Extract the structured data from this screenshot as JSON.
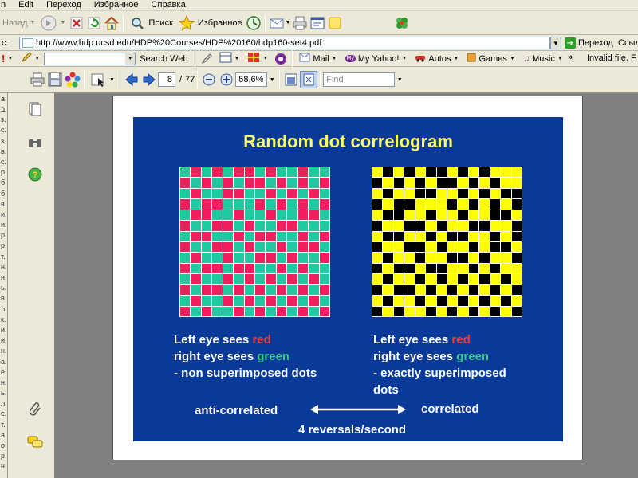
{
  "menubar": {
    "items": [
      "n",
      "Edit",
      "Переход",
      "Избранное",
      "Справка"
    ]
  },
  "toolbar": {
    "back_label": "Назад",
    "search_label": "Поиск",
    "favorites_label": "Избранное"
  },
  "address": {
    "label": "с:",
    "url": "http://www.hdp.ucsd.edu/HDP%20Courses/HDP%20160/hdp160-set4.pdf",
    "go_label": "Переход",
    "links_label": "Ссыл"
  },
  "linksbar": {
    "search_web_label": "Search Web",
    "mail_label": "Mail",
    "myyahoo_label": "My Yahoo!",
    "autos_label": "Autos",
    "games_label": "Games",
    "music_label": "Music",
    "more_label": "»",
    "status_text": "Invalid file. F"
  },
  "pdf_toolbar": {
    "current_page": "8",
    "page_separator": "/",
    "total_pages": "77",
    "zoom": "58,6%",
    "find_placeholder": "Find"
  },
  "left_column": {
    "header": "a",
    "rows": [
      "ב.",
      "з.",
      "с.",
      "з.",
      "в.",
      "с.",
      "р.",
      "б.",
      "б.",
      "в.",
      "и.",
      "и.",
      "р.",
      "р.",
      "т.",
      "н.",
      "н.",
      "ь.",
      "в.",
      "л.",
      "к.",
      "и.",
      "и.",
      "н.",
      "а.",
      "е.",
      "н.",
      "ь.",
      "л.",
      "с.",
      "т.",
      "а.",
      "о.",
      "р.",
      "н."
    ]
  },
  "slide": {
    "title": "Random dot correlogram",
    "left_caption": {
      "line1_prefix": "Left eye sees ",
      "line1_color": "red",
      "line2_prefix": "right eye sees ",
      "line2_color": "green",
      "line3": "- non superimposed dots"
    },
    "right_caption": {
      "line1_prefix": "Left eye sees ",
      "line1_color": "red",
      "line2_prefix": "right eye sees ",
      "line2_color": "green",
      "line3": "- exactly superimposed",
      "line4": "dots"
    },
    "anti_label": "anti-correlated",
    "corr_label": "correlated",
    "reversals": "4 reversals/second",
    "left_grid": {
      "colors": {
        "0": "#22c9a0",
        "1": "#f0205f"
      },
      "cells": [
        "01010110100100",
        "10101011010101",
        "01001100101010",
        "10110001010101",
        "01100100100110",
        "10011010011000",
        "01100101100101",
        "10011010010110",
        "01001001101001",
        "10110110010100",
        "01001010101010",
        "10110101010101",
        "01001010101010",
        "10100101010101"
      ]
    },
    "right_grid": {
      "colors": {
        "0": "#ffff00",
        "1": "#000000"
      },
      "cells": [
        "01010110101000",
        "10101011010100",
        "01001100101011",
        "10110001010101",
        "01100100100110",
        "10011010011001",
        "01100101100101",
        "10011010010110",
        "01001001101001",
        "10110110010100",
        "01001010101010",
        "10110101010101",
        "01001010101010",
        "10100101010101"
      ]
    }
  }
}
